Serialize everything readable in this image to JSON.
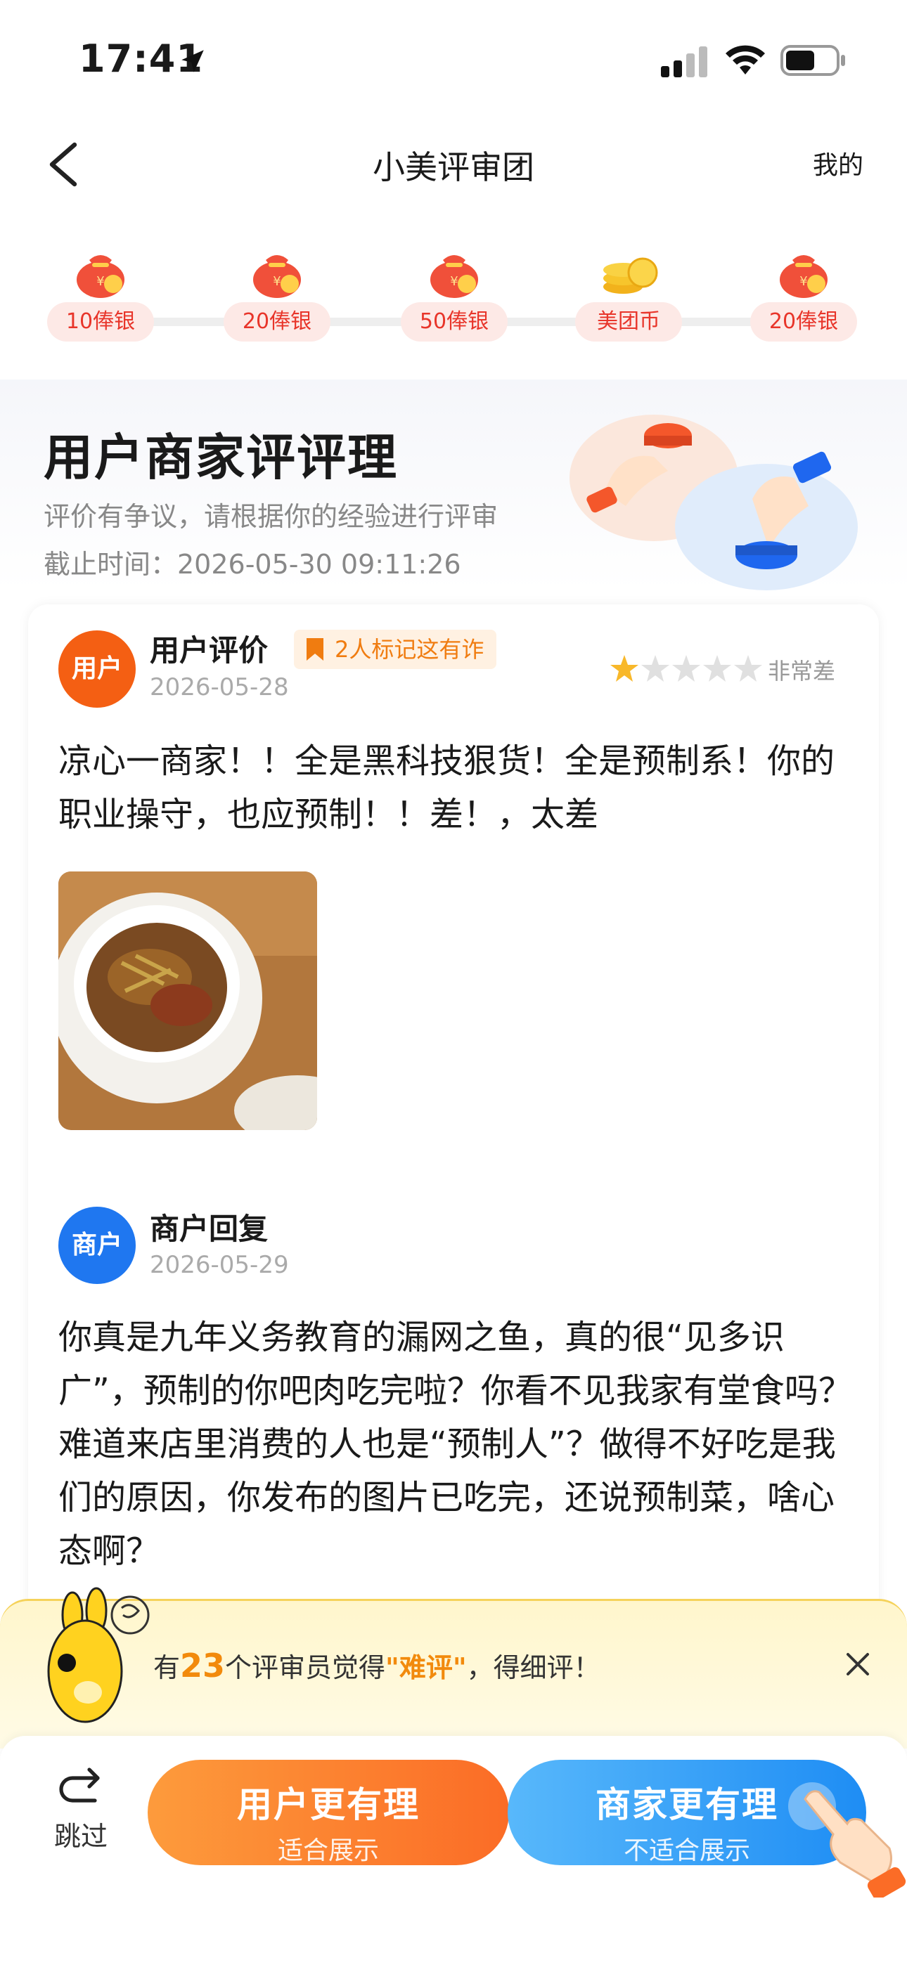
{
  "status_bar": {
    "time": "17:41"
  },
  "nav": {
    "title": "小美评审团",
    "mine": "我的"
  },
  "rewards": [
    {
      "label": "10俸银",
      "icon": "money-bag-icon"
    },
    {
      "label": "20俸银",
      "icon": "money-bag-icon"
    },
    {
      "label": "50俸银",
      "icon": "money-bag-icon"
    },
    {
      "label": "美团币",
      "icon": "coin-stack-icon"
    },
    {
      "label": "20俸银",
      "icon": "money-bag-icon"
    }
  ],
  "header": {
    "title": "用户商家评评理",
    "subtitle": "评价有争议，请根据你的经验进行评审",
    "deadline": "截止时间：2026-05-30 09:11:26"
  },
  "review": {
    "avatar_label": "用户",
    "author": "用户评价",
    "flag_tag": "2人标记这有诈",
    "date": "2026-05-28",
    "stars": 1,
    "rating_text": "非常差",
    "text": "凉心一商家！！全是黑科技狠货！全是预制系！你的职业操守，也应预制！！差！，太差"
  },
  "reply": {
    "avatar_label": "商户",
    "author": "商户回复",
    "date": "2026-05-29",
    "text": "你真是九年义务教育的漏网之鱼，真的很“见多识广”，预制的你吧肉吃完啦？你看不见我家有堂食吗？难道来店里消费的人也是“预制人”？做得不好吃是我们的原因，你发布的图片已吃完，还说预制菜，啥心态啊？"
  },
  "hint": {
    "prefix": "有",
    "count": "23",
    "middle": "个评审员觉得",
    "highlight": "\"难评\"",
    "suffix": "，得细评！"
  },
  "bottom": {
    "skip": "跳过",
    "user_button": {
      "main": "用户更有理",
      "sub": "适合展示"
    },
    "shop_button": {
      "main": "商家更有理",
      "sub": "不适合展示"
    }
  },
  "colors": {
    "accent_orange": "#fb6c26",
    "accent_blue": "#1e8df4",
    "reward_red": "#e8352a"
  }
}
